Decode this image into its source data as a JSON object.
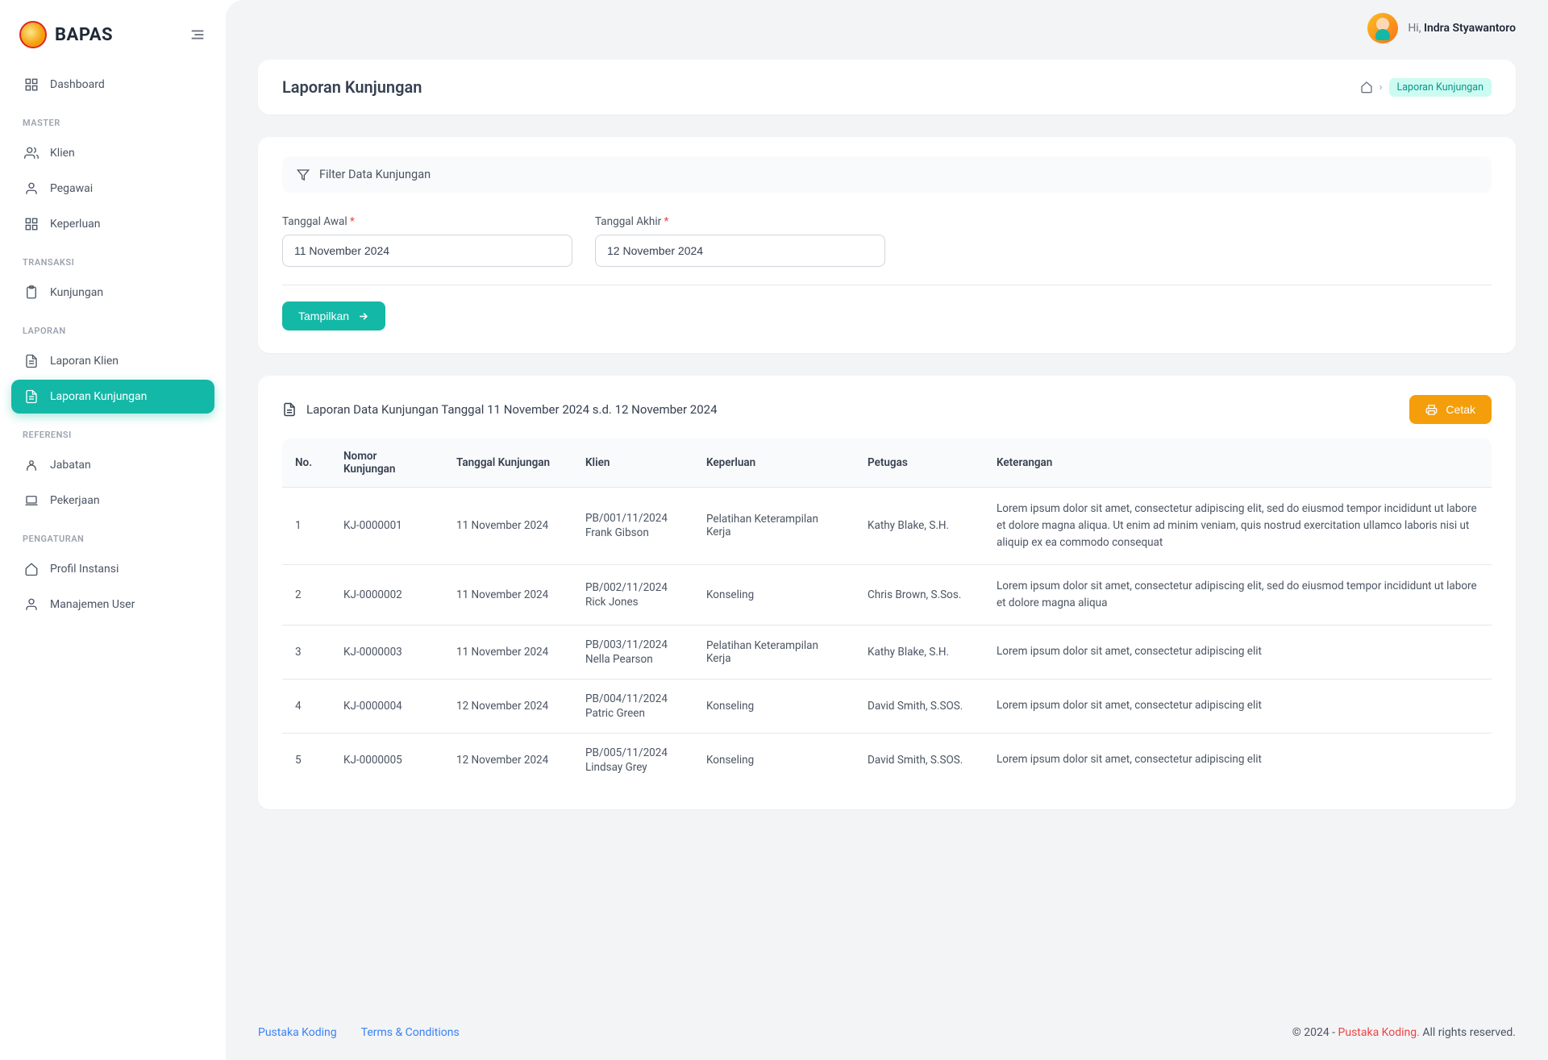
{
  "brand": {
    "name": "BAPAS"
  },
  "topbar": {
    "greeting": "Hi,",
    "username": "Indra Styawantoro"
  },
  "sidebar": {
    "sections": [
      {
        "label": "",
        "items": [
          {
            "key": "dashboard",
            "label": "Dashboard",
            "icon": "grid"
          }
        ]
      },
      {
        "label": "MASTER",
        "items": [
          {
            "key": "klien",
            "label": "Klien",
            "icon": "users"
          },
          {
            "key": "pegawai",
            "label": "Pegawai",
            "icon": "user"
          },
          {
            "key": "keperluan",
            "label": "Keperluan",
            "icon": "grid"
          }
        ]
      },
      {
        "label": "TRANSAKSI",
        "items": [
          {
            "key": "kunjungan",
            "label": "Kunjungan",
            "icon": "clipboard"
          }
        ]
      },
      {
        "label": "LAPORAN",
        "items": [
          {
            "key": "laporan-klien",
            "label": "Laporan Klien",
            "icon": "file"
          },
          {
            "key": "laporan-kunjungan",
            "label": "Laporan Kunjungan",
            "icon": "file",
            "active": true
          }
        ]
      },
      {
        "label": "REFERENSI",
        "items": [
          {
            "key": "jabatan",
            "label": "Jabatan",
            "icon": "user-badge"
          },
          {
            "key": "pekerjaan",
            "label": "Pekerjaan",
            "icon": "laptop"
          }
        ]
      },
      {
        "label": "PENGATURAN",
        "items": [
          {
            "key": "profil-instansi",
            "label": "Profil Instansi",
            "icon": "home"
          },
          {
            "key": "manajemen-user",
            "label": "Manajemen User",
            "icon": "user"
          }
        ]
      }
    ]
  },
  "page": {
    "title": "Laporan Kunjungan",
    "breadcrumb_current": "Laporan Kunjungan"
  },
  "filter": {
    "heading": "Filter Data Kunjungan",
    "start_label": "Tanggal Awal",
    "end_label": "Tanggal Akhir",
    "start_value": "11 November 2024",
    "end_value": "12 November 2024",
    "submit_label": "Tampilkan"
  },
  "report": {
    "title": "Laporan Data Kunjungan Tanggal 11 November 2024 s.d. 12 November 2024",
    "print_label": "Cetak",
    "columns": {
      "no": "No.",
      "nomor": "Nomor Kunjungan",
      "tanggal": "Tanggal Kunjungan",
      "klien": "Klien",
      "keperluan": "Keperluan",
      "petugas": "Petugas",
      "keterangan": "Keterangan"
    },
    "rows": [
      {
        "no": "1",
        "nomor": "KJ-0000001",
        "tanggal": "11 November 2024",
        "klien_kode": "PB/001/11/2024",
        "klien_nama": "Frank Gibson",
        "keperluan": "Pelatihan Keterampilan Kerja",
        "petugas": "Kathy Blake, S.H.",
        "keterangan": "Lorem ipsum dolor sit amet, consectetur adipiscing elit, sed do eiusmod tempor incididunt ut labore et dolore magna aliqua. Ut enim ad minim veniam, quis nostrud exercitation ullamco laboris nisi ut aliquip ex ea commodo consequat"
      },
      {
        "no": "2",
        "nomor": "KJ-0000002",
        "tanggal": "11 November 2024",
        "klien_kode": "PB/002/11/2024",
        "klien_nama": "Rick Jones",
        "keperluan": "Konseling",
        "petugas": "Chris Brown, S.Sos.",
        "keterangan": "Lorem ipsum dolor sit amet, consectetur adipiscing elit, sed do eiusmod tempor incididunt ut labore et dolore magna aliqua"
      },
      {
        "no": "3",
        "nomor": "KJ-0000003",
        "tanggal": "11 November 2024",
        "klien_kode": "PB/003/11/2024",
        "klien_nama": "Nella Pearson",
        "keperluan": "Pelatihan Keterampilan Kerja",
        "petugas": "Kathy Blake, S.H.",
        "keterangan": "Lorem ipsum dolor sit amet, consectetur adipiscing elit"
      },
      {
        "no": "4",
        "nomor": "KJ-0000004",
        "tanggal": "12 November 2024",
        "klien_kode": "PB/004/11/2024",
        "klien_nama": "Patric Green",
        "keperluan": "Konseling",
        "petugas": "David Smith, S.SOS.",
        "keterangan": "Lorem ipsum dolor sit amet, consectetur adipiscing elit"
      },
      {
        "no": "5",
        "nomor": "KJ-0000005",
        "tanggal": "12 November 2024",
        "klien_kode": "PB/005/11/2024",
        "klien_nama": "Lindsay Grey",
        "keperluan": "Konseling",
        "petugas": "David Smith, S.SOS.",
        "keterangan": "Lorem ipsum dolor sit amet, consectetur adipiscing elit"
      }
    ]
  },
  "footer": {
    "link1": "Pustaka Koding",
    "link2": "Terms & Conditions",
    "copyright_prefix": "© 2024 - ",
    "copyright_link": "Pustaka Koding.",
    "copyright_suffix": " All rights reserved."
  }
}
